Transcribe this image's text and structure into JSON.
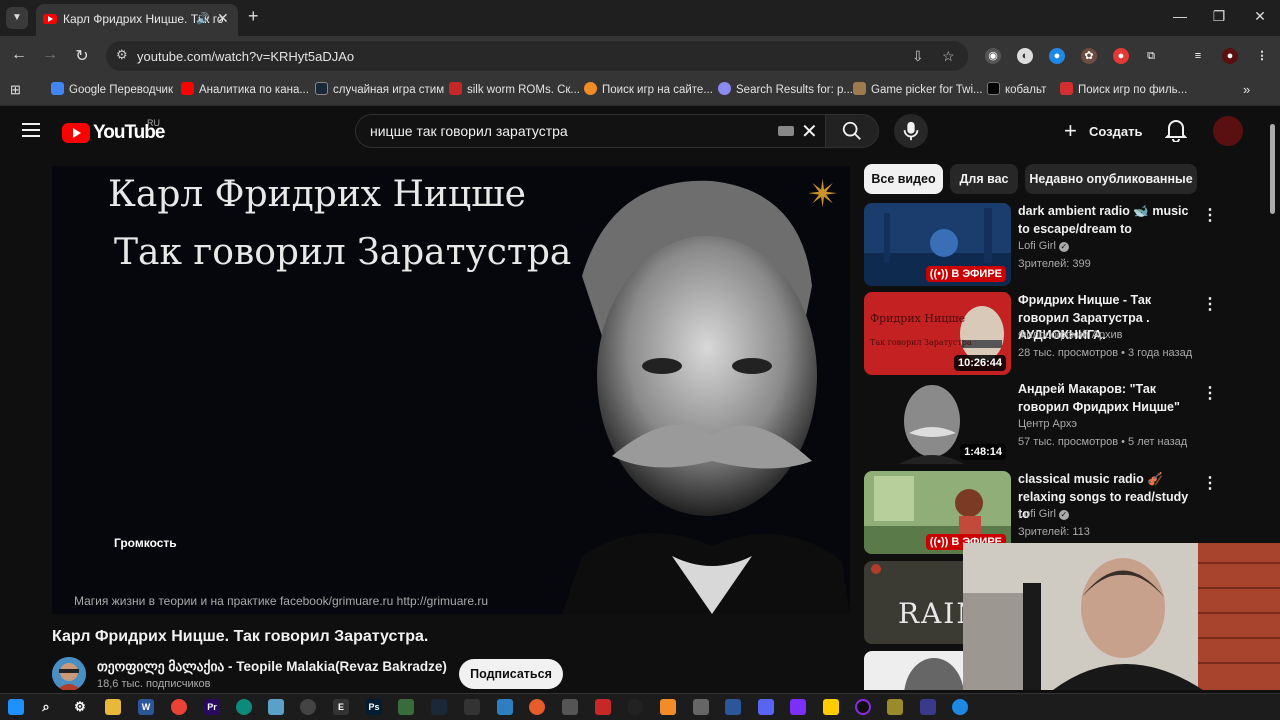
{
  "browser": {
    "tab_title": "Карл Фридрих Ницше. Так говорил Заратустра",
    "url": "youtube.com/watch?v=KRHyt5aDJAo",
    "bookmarks": [
      {
        "label": "Google Переводчик",
        "icon": "google-translate-icon",
        "color": "#4285f4"
      },
      {
        "label": "Аналитика по кана...",
        "icon": "youtube-icon",
        "color": "#ff0000"
      },
      {
        "label": "случайная игра стим",
        "icon": "steam-icon",
        "color": "#1b2838"
      },
      {
        "label": "silk worm ROMs. Ск...",
        "icon": "roms-icon",
        "color": "#c62828"
      },
      {
        "label": "Поиск игр на сайте...",
        "icon": "games-search-icon",
        "color": "#f28c28"
      },
      {
        "label": "Search Results for: p...",
        "icon": "search-results-icon",
        "color": "#8a8af0"
      },
      {
        "label": "Game picker for Twi...",
        "icon": "game-picker-icon",
        "color": "#9e7b4f"
      },
      {
        "label": "кобальт",
        "icon": "cobalt-icon",
        "color": "#000000"
      },
      {
        "label": "Поиск игр по филь...",
        "icon": "film-games-icon",
        "color": "#d32f2f"
      }
    ]
  },
  "youtube": {
    "logo_text": "YouTube",
    "logo_region": "RU",
    "search_query": "ницше так говорил заратустра",
    "create_label": "Создать",
    "video": {
      "overlay_title_line1": "Карл Фридрих Ницше",
      "overlay_title_line2": "Так говорил Заратустра",
      "volume_label": "Громкость",
      "footer_text": "Магия жизни в теории  и  на  практике   facebook/grimuare.ru      http://grimuare.ru",
      "title": "Карл Фридрих Ницше. Так говорил Заратустра.",
      "channel_name": "თეოფილე მალაქია - Teopile Malakia(Revaz Bakradze)",
      "channel_subs": "18,6 тыс. подписчиков",
      "subscribe_label": "Подписаться"
    },
    "chips": [
      "Все видео",
      "Для вас",
      "Недавно опубликованные"
    ],
    "recommendations": [
      {
        "title": "dark ambient radio 🐋 music to escape/dream to",
        "channel": "Lofi Girl",
        "verified": true,
        "meta": "Зрителей: 399",
        "badge": "((•)) В ЭФИРЕ",
        "live": true
      },
      {
        "title": "Фридрих Ницше - Так говорил Заратустра . АУДИОКНИГА.",
        "channel": "Философский Архив",
        "verified": false,
        "meta": "28 тыс. просмотров • 3 года назад",
        "badge": "10:26:44",
        "live": false,
        "thumb_text1": "Фридрих Ницше",
        "thumb_text2": "Так говорил Заратустра"
      },
      {
        "title": "Андрей Макаров: \"Так говорил Фридрих Ницше\"",
        "channel": "Центр Архэ",
        "verified": false,
        "meta": "57 тыс. просмотров • 5 лет назад",
        "badge": "1:48:14",
        "live": false
      },
      {
        "title": "classical music radio 🎻 relaxing songs to read/study to",
        "channel": "Lofi Girl",
        "verified": true,
        "meta": "Зрителей: 113",
        "badge": "((•)) В ЭФИРЕ",
        "live": true
      },
      {
        "thumb_text": "RAIN"
      }
    ]
  }
}
